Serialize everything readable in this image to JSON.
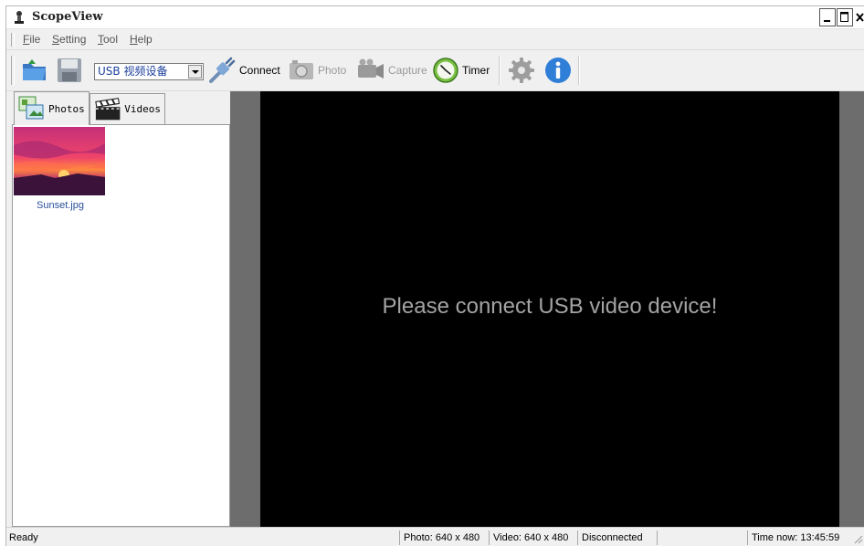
{
  "window": {
    "title": "ScopeView"
  },
  "menu": [
    {
      "mnemonic": "F",
      "rest": "ile"
    },
    {
      "mnemonic": "S",
      "rest": "etting"
    },
    {
      "mnemonic": "T",
      "rest": "ool"
    },
    {
      "mnemonic": "H",
      "rest": "elp"
    }
  ],
  "toolbar": {
    "device": "USB 视频设备",
    "connect_label": "Connect",
    "photo_label": "Photo",
    "capture_label": "Capture",
    "timer_label": "Timer"
  },
  "tabs": {
    "photos": "Photos",
    "videos": "Videos"
  },
  "gallery": {
    "items": [
      {
        "name": "Sunset.jpg"
      }
    ]
  },
  "preview": {
    "message": "Please connect USB video device!"
  },
  "status": {
    "state": "Ready",
    "photo_res": "Photo: 640 x 480",
    "video_res": "Video: 640 x 480",
    "connection": "Disconnected",
    "time": "Time now: 13:45:59"
  },
  "colors": {
    "preview_bg": "#000000",
    "preview_frame": "#6d6d6d",
    "message_text": "#a3a3a3",
    "link_blue": "#2a4f9c"
  }
}
